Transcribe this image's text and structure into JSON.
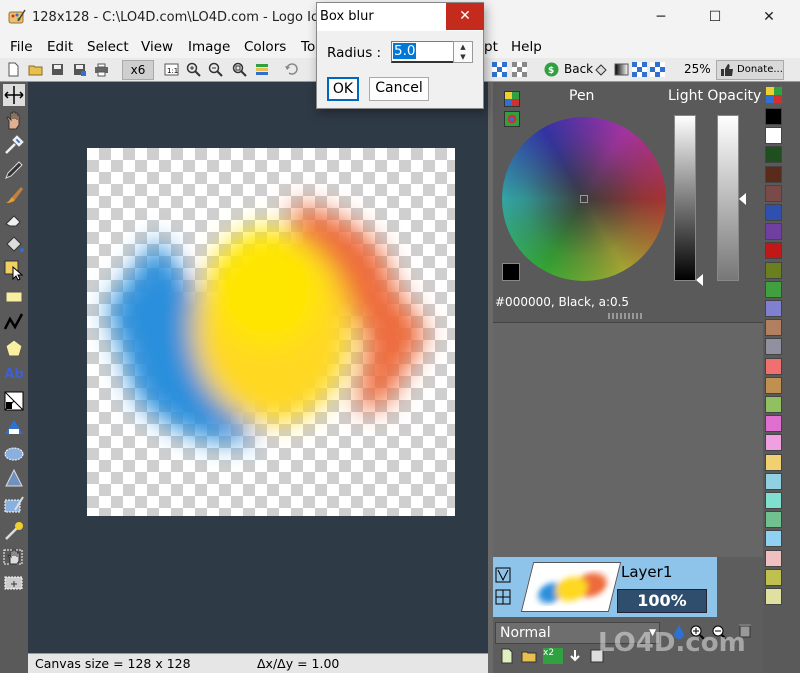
{
  "window": {
    "title": "128x128 - C:\\LO4D.com\\LO4D.com - Logo Ico",
    "minimize_icon": "─",
    "maximize_icon": "☐",
    "close_icon": "✕"
  },
  "menu": [
    "File",
    "Edit",
    "Select",
    "View",
    "Image",
    "Colors",
    "To",
    "pt",
    "Help"
  ],
  "toolbar": {
    "zoom_factor": "x6",
    "back_label": "Back",
    "zoom_percent": "25%",
    "donate_label": "Donate..."
  },
  "dialog": {
    "title": "Box blur",
    "close_icon": "✕",
    "radius_label": "Radius :",
    "radius_value": "5.0",
    "ok_label": "OK",
    "cancel_label": "Cancel"
  },
  "tools": {
    "text_tool_label": "Ab"
  },
  "color_panel": {
    "pen_label": "Pen",
    "opacity_label": "Light Opacity",
    "readout": "#000000, Black, a:0.5"
  },
  "layer": {
    "name": "Layer1",
    "opacity": "100%",
    "blend_mode": "Normal",
    "x2_label": "x2"
  },
  "status": {
    "canvas_size": "Canvas size = 128 x 128",
    "delta": "Δx/Δy = 1.00"
  },
  "palette_colors": [
    "#000000",
    "#ffffff",
    "#1f4f1f",
    "#5a2a1a",
    "#7a4a4a",
    "#3050b0",
    "#7040a0",
    "#c01818",
    "#6a8020",
    "#40a040",
    "#8080d0",
    "#b08060",
    "#9090a0",
    "#f07070",
    "#c09050",
    "#90c060",
    "#e070d0",
    "#f0a0e0",
    "#f0d070",
    "#90d0e0",
    "#80e0d0",
    "#70c090",
    "#90d0f0",
    "#f0c0c0",
    "#c0c050",
    "#e0e0a0"
  ],
  "watermark": "LO4D.com"
}
